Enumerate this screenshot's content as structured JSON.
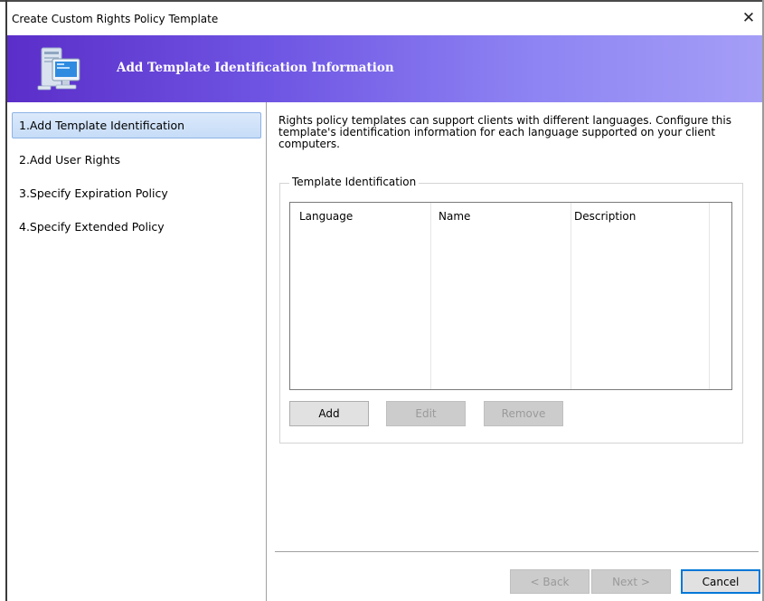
{
  "window": {
    "title": "Create Custom Rights Policy Template",
    "close_glyph": "✕"
  },
  "banner": {
    "title": "Add Template Identification Information",
    "icon": "computer-monitor-icon",
    "gradient_start": "#5b2ec9",
    "gradient_end": "#a59ef6"
  },
  "nav": {
    "items": [
      {
        "label": "1.Add Template Identification",
        "selected": true
      },
      {
        "label": "2.Add User Rights",
        "selected": false
      },
      {
        "label": "3.Specify Expiration Policy",
        "selected": false
      },
      {
        "label": "4.Specify Extended Policy",
        "selected": false
      }
    ]
  },
  "content": {
    "description": "Rights policy templates can support clients with different languages. Configure this template's identification information for each language supported on your client computers.",
    "group_title": "Template Identification",
    "columns": [
      "Language",
      "Name",
      "Description"
    ],
    "rows": [],
    "buttons": {
      "add": "Add",
      "edit": "Edit",
      "remove": "Remove"
    }
  },
  "footer": {
    "back": "< Back",
    "next": "Next >",
    "cancel": "Cancel"
  }
}
